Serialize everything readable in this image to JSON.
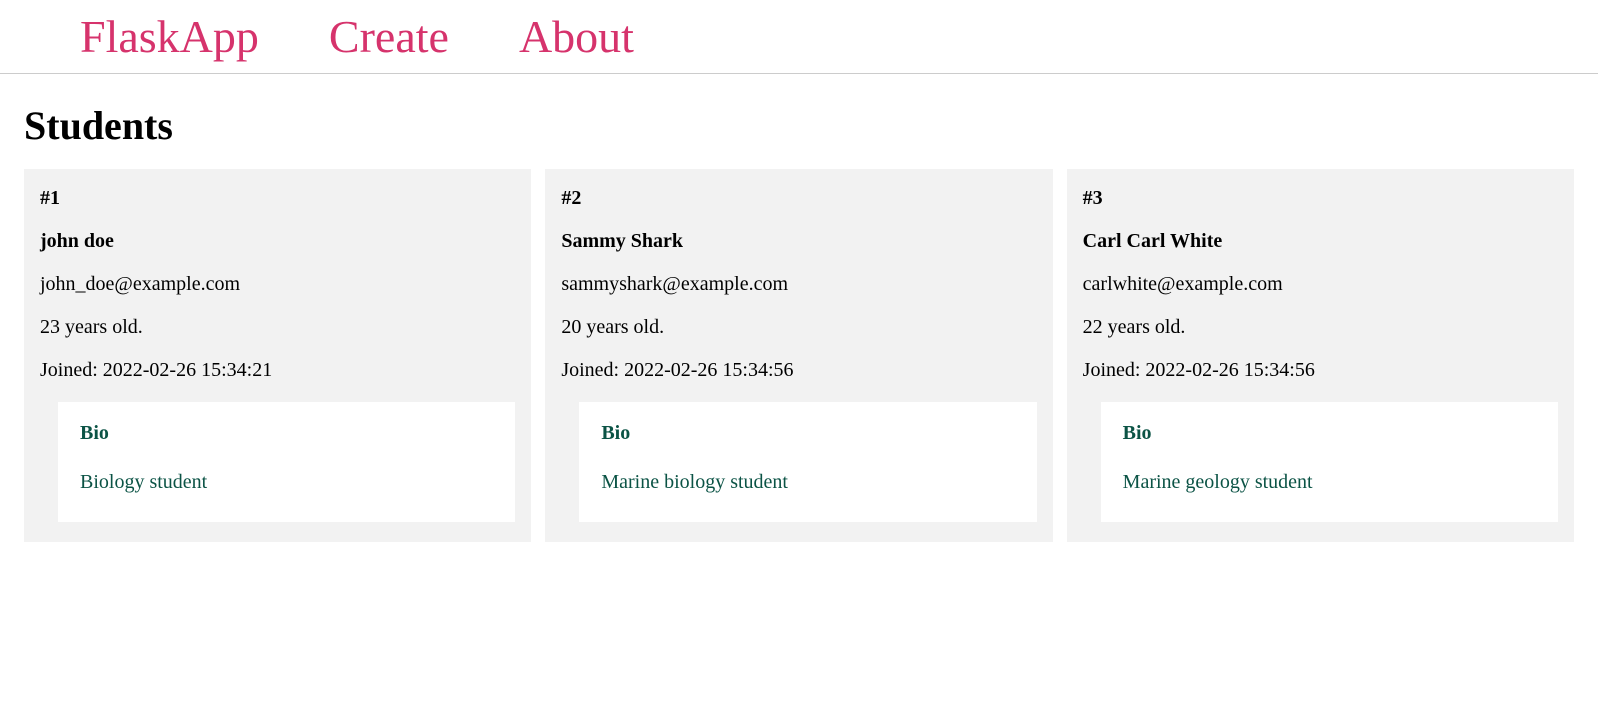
{
  "nav": {
    "brand": "FlaskApp",
    "create": "Create",
    "about": "About"
  },
  "page": {
    "title": "Students"
  },
  "labels": {
    "joined_prefix": "Joined: ",
    "years_suffix": " years old.",
    "bio_heading": "Bio"
  },
  "students": [
    {
      "id_display": "#1",
      "name": "john doe",
      "email": "john_doe@example.com",
      "age_text": "23 years old.",
      "joined_text": "Joined: 2022-02-26 15:34:21",
      "bio": "Biology student"
    },
    {
      "id_display": "#2",
      "name": "Sammy Shark",
      "email": "sammyshark@example.com",
      "age_text": "20 years old.",
      "joined_text": "Joined: 2022-02-26 15:34:56",
      "bio": "Marine biology student"
    },
    {
      "id_display": "#3",
      "name": "Carl Carl White",
      "email": "carlwhite@example.com",
      "age_text": "22 years old.",
      "joined_text": "Joined: 2022-02-26 15:34:56",
      "bio": "Marine geology student"
    }
  ]
}
